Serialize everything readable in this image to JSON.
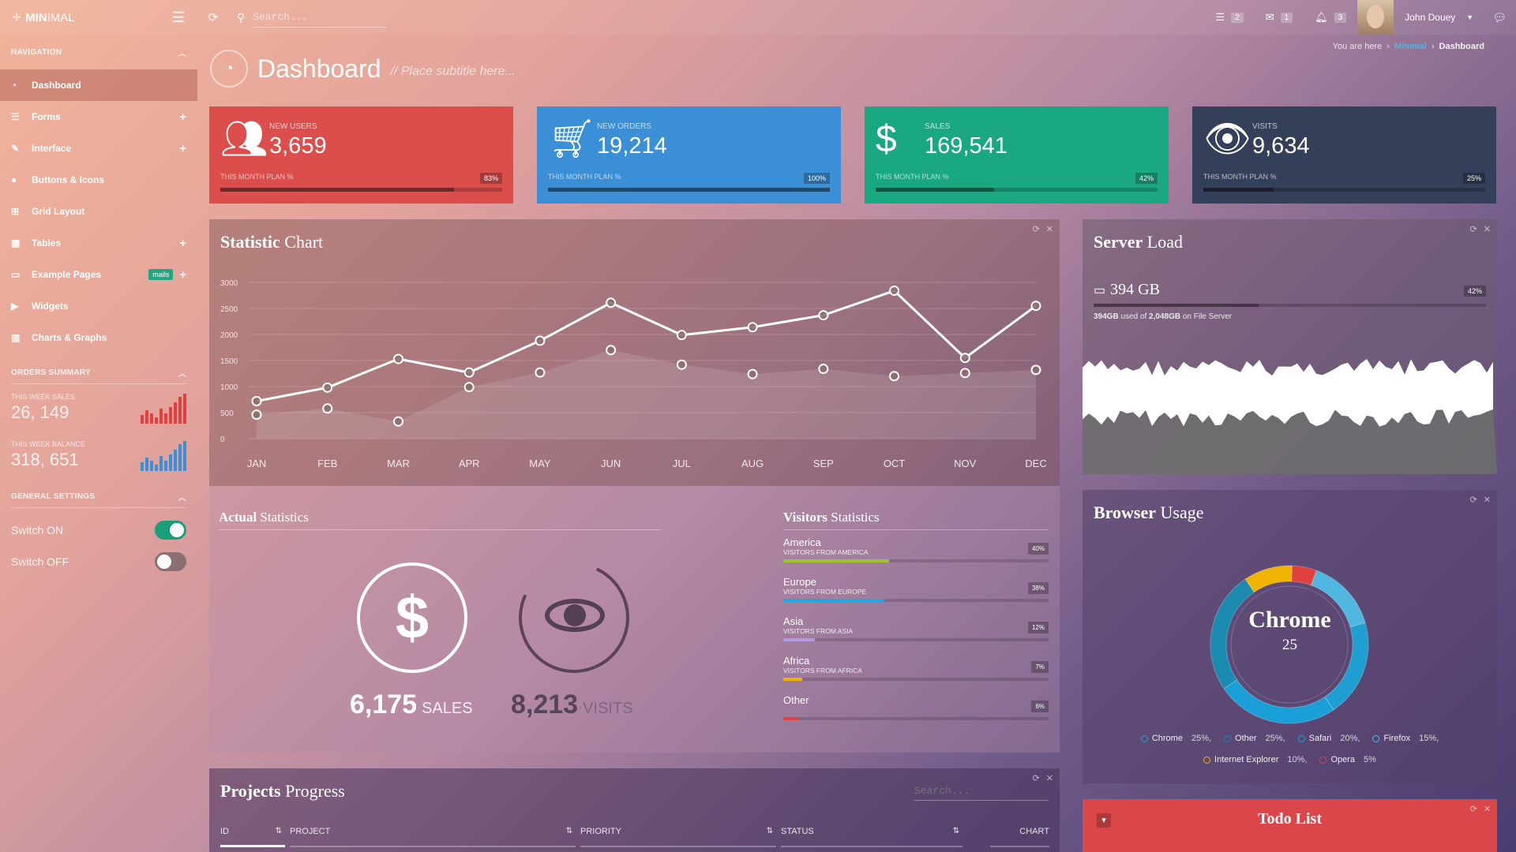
{
  "topbar": {
    "brand_bold": "MIN",
    "brand_thin": "IMAL",
    "search_placeholder": "Search...",
    "tasks_count": "2",
    "mail_count": "1",
    "notif_count": "3",
    "user_name": "John Douey"
  },
  "sidebar": {
    "nav_header": "NAVIGATION",
    "items": [
      {
        "label": "Dashboard",
        "icon": "dashboard-icon"
      },
      {
        "label": "Forms",
        "icon": "list-icon"
      },
      {
        "label": "Interface",
        "icon": "pencil-icon"
      },
      {
        "label": "Buttons & Icons",
        "icon": "tint-icon"
      },
      {
        "label": "Grid Layout",
        "icon": "grid-icon"
      },
      {
        "label": "Tables",
        "icon": "table-icon"
      },
      {
        "label": "Example Pages",
        "icon": "monitor-icon",
        "tag": "mails"
      },
      {
        "label": "Widgets",
        "icon": "play-circle-icon"
      },
      {
        "label": "Charts & Graphs",
        "icon": "bar-chart-icon"
      }
    ],
    "orders_header": "ORDERS SUMMARY",
    "week_sales_label": "THIS WEEK SALES",
    "week_sales_value": "26, 149",
    "week_balance_label": "THIS WEEK BALANCE",
    "week_balance_value": "318, 651",
    "settings_header": "GENERAL SETTINGS",
    "switch_on_label": "Switch ON",
    "switch_off_label": "Switch OFF",
    "sales_bars": [
      0.3,
      0.45,
      0.35,
      0.2,
      0.5,
      0.35,
      0.55,
      0.7,
      0.9,
      1.0
    ],
    "balance_bars": [
      0.3,
      0.45,
      0.35,
      0.2,
      0.5,
      0.35,
      0.55,
      0.7,
      0.9,
      1.0
    ],
    "sales_bar_color": "#e0413f",
    "balance_bar_color": "#3a8fd6"
  },
  "breadcrumb": {
    "prefix": "You are here",
    "link": "Minimal",
    "current": "Dashboard"
  },
  "page": {
    "title": "Dashboard",
    "subtitle": "// Place subtitle here..."
  },
  "stats": [
    {
      "label": "NEW USERS",
      "value": "3,659",
      "plan": "THIS MONTH PLAN %",
      "pct": "83%",
      "fill": 0.83,
      "color": "#dc4e4b",
      "icon": "users-icon"
    },
    {
      "label": "NEW ORDERS",
      "value": "19,214",
      "plan": "THIS MONTH PLAN %",
      "pct": "100%",
      "fill": 1.0,
      "color": "#3a8fd6",
      "icon": "cart-icon"
    },
    {
      "label": "SALES",
      "value": "169,541",
      "plan": "THIS MONTH PLAN %",
      "pct": "42%",
      "fill": 0.42,
      "color": "#1aa883",
      "icon": "dollar-icon"
    },
    {
      "label": "VISITS",
      "value": "9,634",
      "plan": "THIS MONTH PLAN %",
      "pct": "25%",
      "fill": 0.25,
      "color": "#34405a",
      "icon": "eye-icon"
    }
  ],
  "statistic_chart": {
    "title_bold": "Statistic",
    "title_rest": " Chart"
  },
  "chart_data": {
    "type": "line",
    "categories": [
      "JAN",
      "FEB",
      "MAR",
      "APR",
      "MAY",
      "JUN",
      "JUL",
      "AUG",
      "SEP",
      "OCT",
      "NOV",
      "DEC"
    ],
    "series": [
      {
        "values": [
          720,
          980,
          1530,
          1270,
          1880,
          2610,
          1990,
          2140,
          2370,
          2840,
          1550,
          2550
        ]
      },
      {
        "values": [
          460,
          580,
          330,
          990,
          1270,
          1700,
          1420,
          1240,
          1340,
          1200,
          1260,
          1320
        ]
      }
    ],
    "yticks": [
      0,
      500,
      1000,
      1500,
      2000,
      2500,
      3000
    ],
    "ylim": [
      0,
      3000
    ]
  },
  "server_load": {
    "title_bold": "Server",
    "title_rest": " Load",
    "value": "394 GB",
    "pct": "42%",
    "fill": 0.42,
    "used": "394GB",
    "used_of": " used of ",
    "total": "2,048GB",
    "on": " on File Server"
  },
  "actual": {
    "title_bold": "Actual",
    "title_rest": " Statistics",
    "sales_value": "6,175",
    "sales_label": "SALES",
    "visits_value": "8,213",
    "visits_label": "VISITS"
  },
  "visitors": {
    "title_bold": "Visitors",
    "title_rest": " Statistics",
    "rows": [
      {
        "name": "America",
        "sub": "VISITORS FROM AMERICA",
        "pct": "40%",
        "fill": 0.4,
        "color": "#9bc52a"
      },
      {
        "name": "Europe",
        "sub": "VISITORS FROM EUROPE",
        "pct": "38%",
        "fill": 0.38,
        "color": "#1fa9e1"
      },
      {
        "name": "Asia",
        "sub": "VISITORS FROM ASIA",
        "pct": "12%",
        "fill": 0.12,
        "color": "#b19ae0"
      },
      {
        "name": "Africa",
        "sub": "VISITORS FROM AFRICA",
        "pct": "7%",
        "fill": 0.07,
        "color": "#f0b400"
      },
      {
        "name": "Other",
        "sub": "",
        "pct": "6%",
        "fill": 0.06,
        "color": "#e0413f"
      }
    ]
  },
  "browser": {
    "title_bold": "Browser",
    "title_rest": " Usage",
    "center_label": "Chrome",
    "center_value": "25",
    "slices": [
      {
        "name": "Chrome",
        "value": 25,
        "color": "#1a9fd8"
      },
      {
        "name": "Other",
        "value": 25,
        "color": "#1a8ab0"
      },
      {
        "name": "Safari",
        "value": 20,
        "color": "#1f9ed1"
      },
      {
        "name": "Firefox",
        "value": 15,
        "color": "#4fb7e0"
      },
      {
        "name": "Internet Explorer",
        "value": 10,
        "color": "#f0b400"
      },
      {
        "name": "Opera",
        "value": 5,
        "color": "#e0413f"
      }
    ],
    "legend": [
      {
        "name": "Chrome",
        "pct": "25%,",
        "color": "#1a9fd8"
      },
      {
        "name": "Other",
        "pct": "25%,",
        "color": "#1a8ab0"
      },
      {
        "name": "Safari",
        "pct": "20%,",
        "color": "#1f9ed1"
      },
      {
        "name": "Firefox",
        "pct": "15%,",
        "color": "#4fb7e0"
      },
      {
        "name": "Internet Explorer",
        "pct": "10%,",
        "color": "#f0b400"
      },
      {
        "name": "Opera",
        "pct": "5%",
        "color": "#e0413f"
      }
    ]
  },
  "projects": {
    "title_bold": "Projects",
    "title_rest": " Progress",
    "search_placeholder": "Search...",
    "columns": [
      "ID",
      "PROJECT",
      "PRIORITY",
      "STATUS",
      "CHART"
    ]
  },
  "todo": {
    "title": "Todo List"
  }
}
